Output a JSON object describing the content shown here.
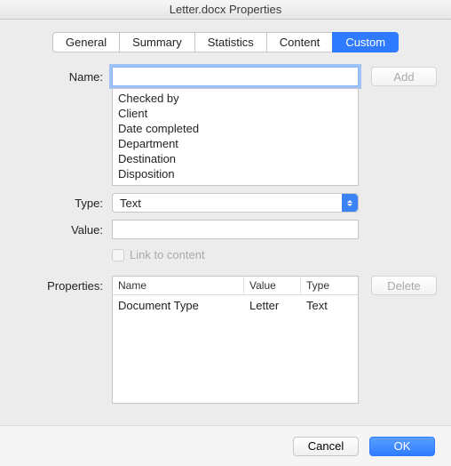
{
  "window": {
    "title": "Letter.docx Properties"
  },
  "tabs": {
    "general": "General",
    "summary": "Summary",
    "statistics": "Statistics",
    "content": "Content",
    "custom": "Custom"
  },
  "labels": {
    "name": "Name:",
    "type": "Type:",
    "value": "Value:",
    "properties": "Properties:",
    "link_to_content": "Link to content"
  },
  "buttons": {
    "add": "Add",
    "delete": "Delete",
    "cancel": "Cancel",
    "ok": "OK"
  },
  "name_input": {
    "value": ""
  },
  "name_suggestions": [
    "Checked by",
    "Client",
    "Date completed",
    "Department",
    "Destination",
    "Disposition"
  ],
  "type_select": {
    "value": "Text"
  },
  "value_input": {
    "value": ""
  },
  "properties_table": {
    "headers": {
      "name": "Name",
      "value": "Value",
      "type": "Type"
    },
    "rows": [
      {
        "name": "Document Type",
        "value": "Letter",
        "type": "Text"
      }
    ]
  }
}
